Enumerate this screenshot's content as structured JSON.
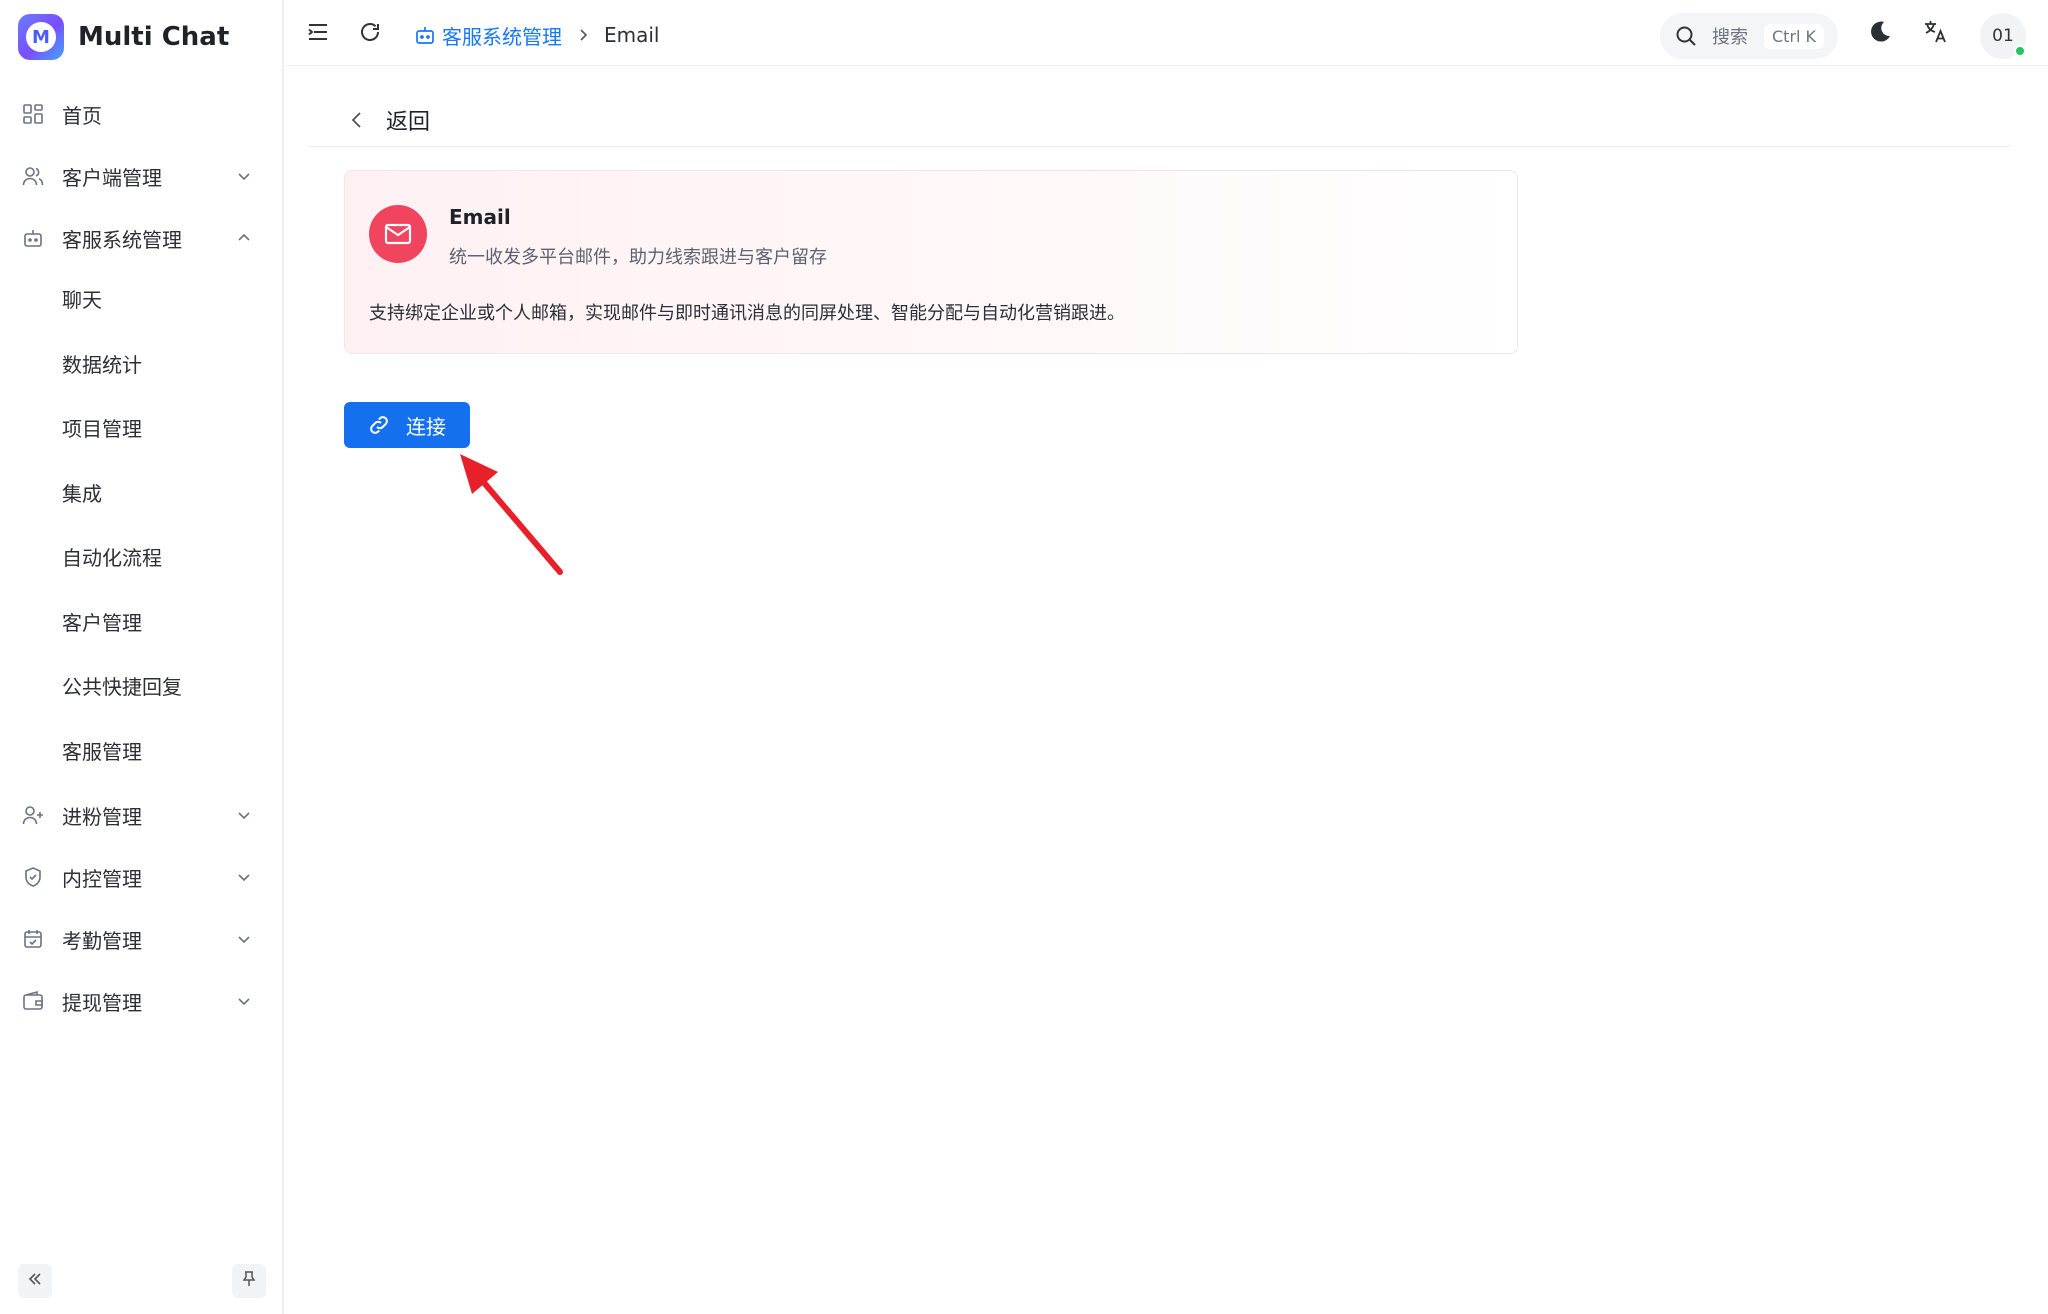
{
  "app": {
    "name": "Multi Chat",
    "logo_letter": "M"
  },
  "sidebar": {
    "items": [
      {
        "label": "首页",
        "icon": "dashboard-icon"
      },
      {
        "label": "客户端管理",
        "icon": "users-icon",
        "expanded": false
      },
      {
        "label": "客服系统管理",
        "icon": "robot-icon",
        "expanded": true,
        "children": [
          "聊天",
          "数据统计",
          "项目管理",
          "集成",
          "自动化流程",
          "客户管理",
          "公共快捷回复",
          "客服管理"
        ]
      },
      {
        "label": "进粉管理",
        "icon": "user-plus-icon",
        "expanded": false
      },
      {
        "label": "内控管理",
        "icon": "shield-icon",
        "expanded": false
      },
      {
        "label": "考勤管理",
        "icon": "calendar-check-icon",
        "expanded": false
      },
      {
        "label": "提现管理",
        "icon": "wallet-icon",
        "expanded": false
      }
    ]
  },
  "header": {
    "breadcrumb": {
      "parent": "客服系统管理",
      "current": "Email"
    },
    "search": {
      "label": "搜索",
      "shortcut": "Ctrl K"
    },
    "avatar": {
      "text": "01",
      "status_color": "#22c55e"
    }
  },
  "main": {
    "back_label": "返回",
    "card": {
      "title": "Email",
      "subtitle": "统一收发多平台邮件，助力线索跟进与客户留存",
      "description": "支持绑定企业或个人邮箱，实现邮件与即时通讯消息的同屏处理、智能分配与自动化营销跟进。",
      "accent": "#f0445f"
    },
    "connect_label": "连接"
  },
  "colors": {
    "primary": "#1570ef",
    "link": "#1677ff",
    "annotation": "#e8202a"
  }
}
